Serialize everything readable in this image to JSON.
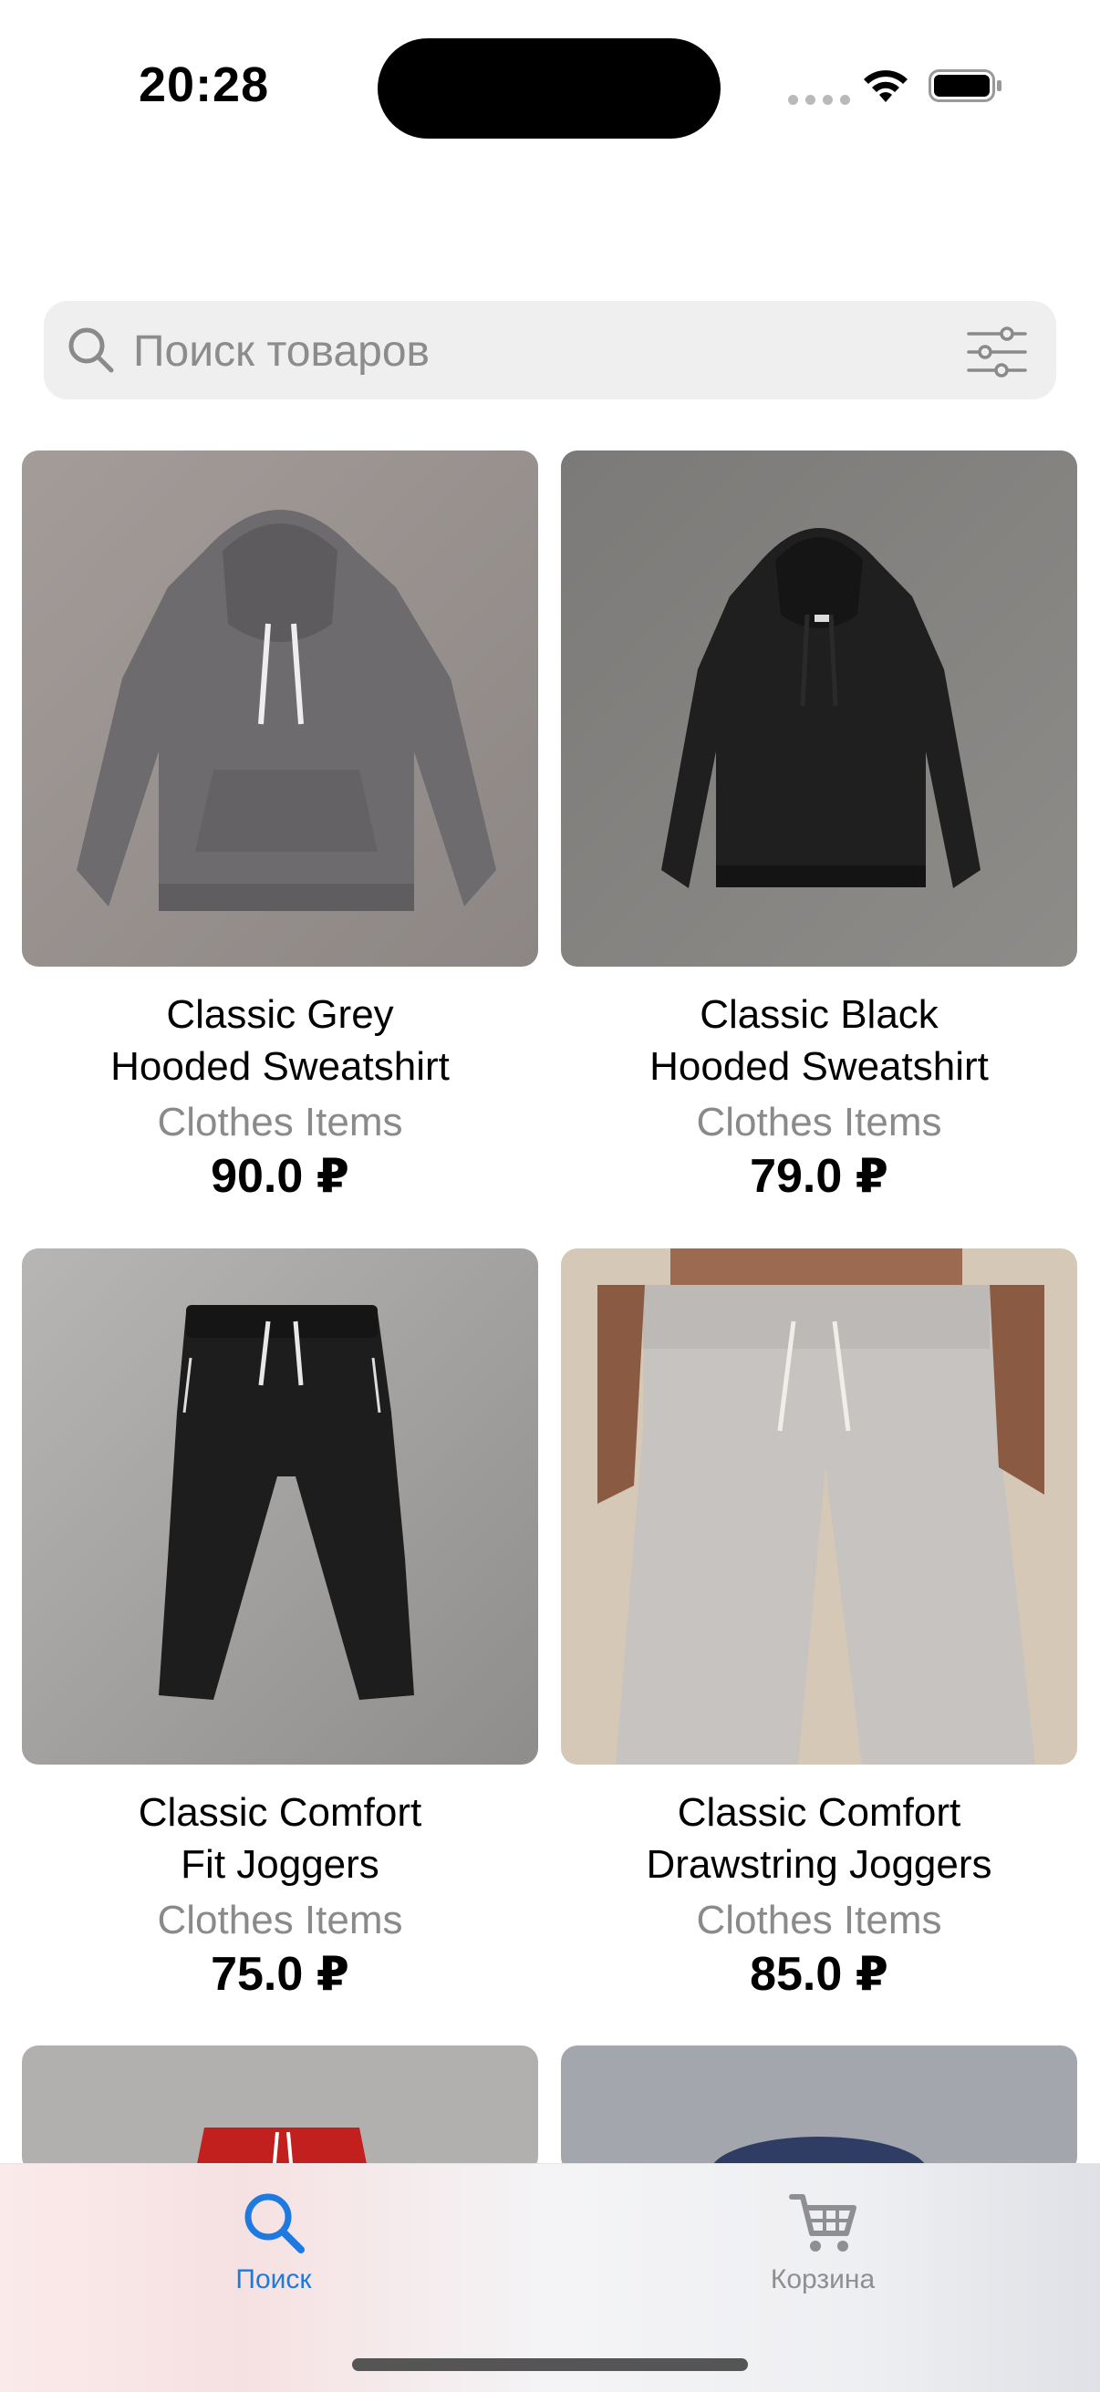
{
  "status_bar": {
    "time": "20:28"
  },
  "search": {
    "placeholder": "Поиск товаров",
    "value": ""
  },
  "products": [
    {
      "name": "Classic Grey\nHooded Sweatshirt",
      "category": "Clothes Items",
      "price": "90.0 ₽"
    },
    {
      "name": "Classic Black\nHooded Sweatshirt",
      "category": "Clothes Items",
      "price": "79.0 ₽"
    },
    {
      "name": "Classic Comfort\nFit Joggers",
      "category": "Clothes Items",
      "price": "75.0 ₽"
    },
    {
      "name": "Classic Comfort\nDrawstring Joggers",
      "category": "Clothes Items",
      "price": "85.0 ₽"
    }
  ],
  "tab_bar": {
    "tabs": [
      {
        "label": "Поиск",
        "icon": "search-icon",
        "active": true
      },
      {
        "label": "Корзина",
        "icon": "cart-icon",
        "active": false
      }
    ]
  },
  "colors": {
    "accent": "#1f7ae0",
    "inactive": "#8e8e93",
    "search_bg": "#efefef"
  }
}
